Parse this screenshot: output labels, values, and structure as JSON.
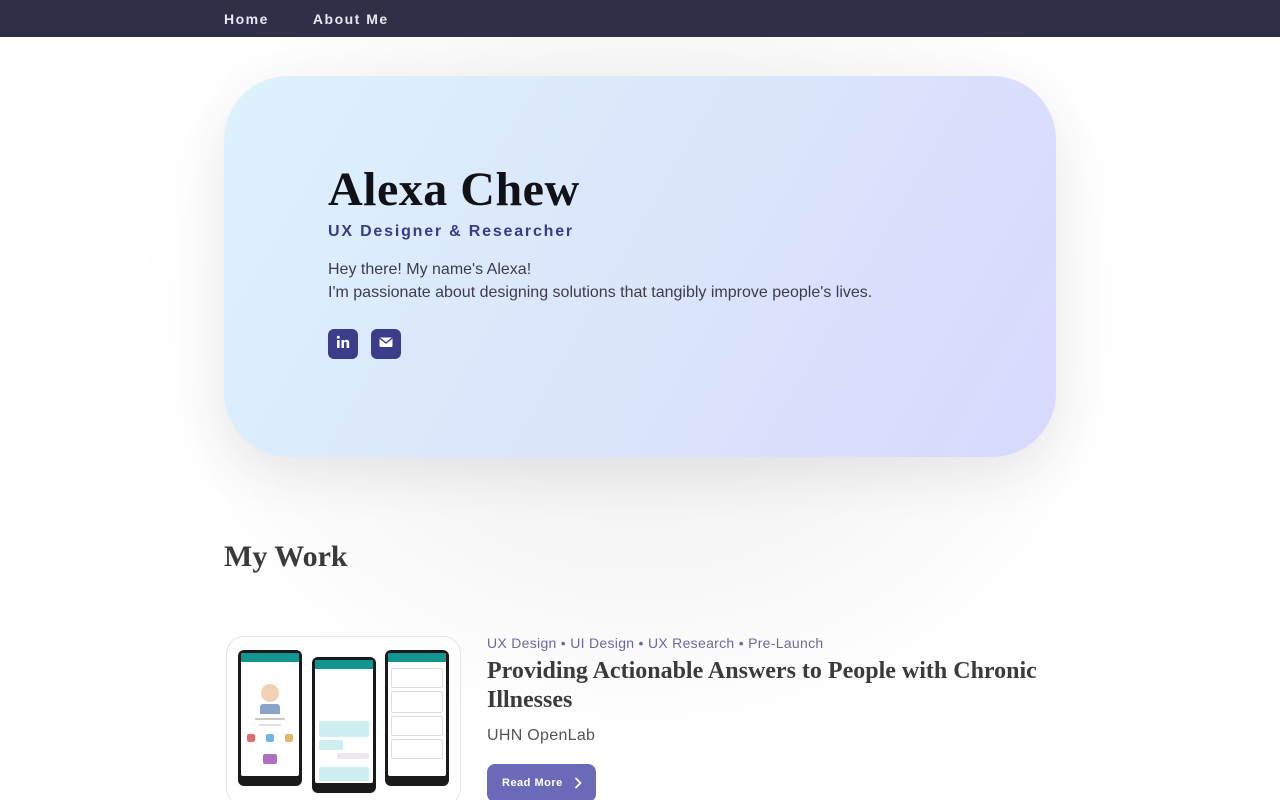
{
  "nav": {
    "items": [
      {
        "label": "Home"
      },
      {
        "label": "About Me"
      }
    ]
  },
  "hero": {
    "name": "Alexa Chew",
    "role": "UX Designer & Researcher",
    "intro_line1": "Hey there! My name's Alexa!",
    "intro_line2": "I'm passionate about designing solutions that tangibly improve people's lives.",
    "socials": [
      {
        "icon": "linkedin-icon"
      },
      {
        "icon": "envelope-icon"
      }
    ]
  },
  "work": {
    "section_title": "My Work",
    "projects": [
      {
        "tags": "UX Design • UI Design • UX Research • Pre-Launch",
        "title": "Providing Actionable Answers to People with Chronic Illnesses",
        "org": "UHN OpenLab",
        "cta": "Read More"
      }
    ]
  },
  "colors": {
    "nav_bg": "#2f2f48",
    "accent": "#3c3d8a",
    "button": "#6a6ab8",
    "app_teal": "#13968f"
  }
}
